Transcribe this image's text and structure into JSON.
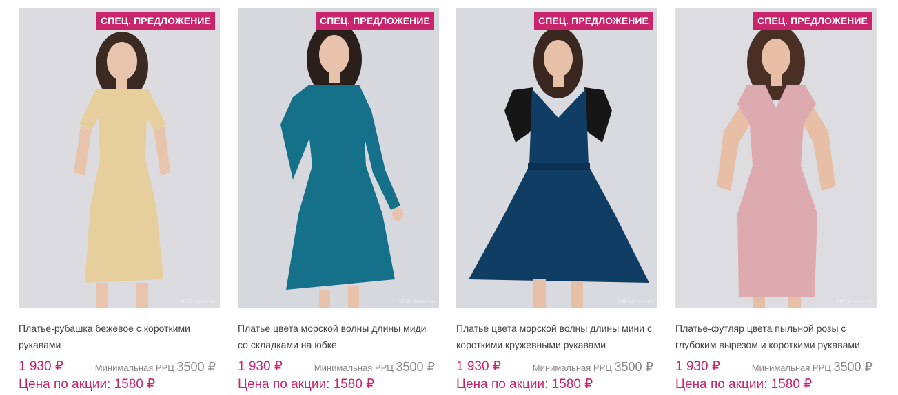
{
  "products": [
    {
      "badge": "СПЕЦ. ПРЕДЛОЖЕНИЕ",
      "title": "Платье-рубашка бежевое с короткими рукавами",
      "price": "1 930 ₽",
      "rrc_label": "Минимальная РРЦ",
      "rrc_value": "3500 ₽",
      "promo": "Цена по акции: 1580 ₽",
      "watermark": "1001dress.ru",
      "dress_color": "#e6cf9c",
      "bg_color": "#dbdbe0"
    },
    {
      "badge": "СПЕЦ. ПРЕДЛОЖЕНИЕ",
      "title": "Платье цвета морской волны длины миди со складками на юбке",
      "price": "1 930 ₽",
      "rrc_label": "Минимальная РРЦ",
      "rrc_value": "3500 ₽",
      "promo": "Цена по акции: 1580 ₽",
      "watermark": "1001dress.ru",
      "dress_color": "#15708a",
      "bg_color": "#d7d8de"
    },
    {
      "badge": "СПЕЦ. ПРЕДЛОЖЕНИЕ",
      "title": "Платье цвета морской волны длины мини с короткими кружевными рукавами",
      "price": "1 930 ₽",
      "rrc_label": "Минимальная РРЦ",
      "rrc_value": "3500 ₽",
      "promo": "Цена по акции: 1580 ₽",
      "watermark": "1001dress.ru",
      "dress_color": "#0f3d63",
      "bg_color": "#d9dadf"
    },
    {
      "badge": "СПЕЦ. ПРЕДЛОЖЕНИЕ",
      "title": "Платье-футляр цвета пыльной розы с глубоким вырезом и короткими рукавами",
      "price": "1 930 ₽",
      "rrc_label": "Минимальная РРЦ",
      "rrc_value": "3500 ₽",
      "promo": "Цена по акции: 1580 ₽",
      "watermark": "1001dress.ru",
      "dress_color": "#ddaab0",
      "bg_color": "#dcdce1"
    }
  ]
}
